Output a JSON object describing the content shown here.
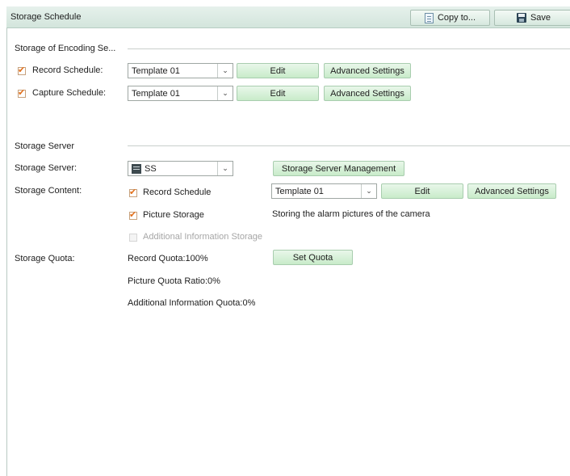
{
  "window": {
    "title": "Storage Schedule"
  },
  "toolbar": {
    "copy_label": "Copy to...",
    "save_label": "Save",
    "copy_icon": "document-copy-icon",
    "save_icon": "floppy-disk-icon"
  },
  "encoding": {
    "section_title": "Storage of Encoding Se...",
    "record": {
      "label": "Record Schedule:",
      "checked": true,
      "template": "Template 01",
      "edit_label": "Edit",
      "advanced_label": "Advanced Settings"
    },
    "capture": {
      "label": "Capture Schedule:",
      "checked": true,
      "template": "Template 01",
      "edit_label": "Edit",
      "advanced_label": "Advanced Settings"
    }
  },
  "server": {
    "section_title": "Storage Server",
    "server_label": "Storage Server:",
    "server_value": "SS",
    "server_icon": "server-icon",
    "management_label": "Storage Server Management",
    "content_label": "Storage Content:",
    "record_schedule": {
      "label": "Record Schedule",
      "checked": true,
      "template": "Template 01",
      "edit_label": "Edit",
      "advanced_label": "Advanced Settings"
    },
    "picture_storage": {
      "label": "Picture Storage",
      "checked": true,
      "description": "Storing the alarm pictures of the camera"
    },
    "additional_info": {
      "label": "Additional Information Storage",
      "checked": false,
      "disabled": true
    },
    "quota_label": "Storage Quota:",
    "record_quota": "Record Quota:100%",
    "set_quota_label": "Set Quota",
    "picture_quota": "Picture Quota Ratio:0%",
    "additional_quota": "Additional Information Quota:0%"
  },
  "colors": {
    "title_bar": "#d9e9e1",
    "check_mark": "#e2701c",
    "button_green": "#c8ebc9"
  }
}
